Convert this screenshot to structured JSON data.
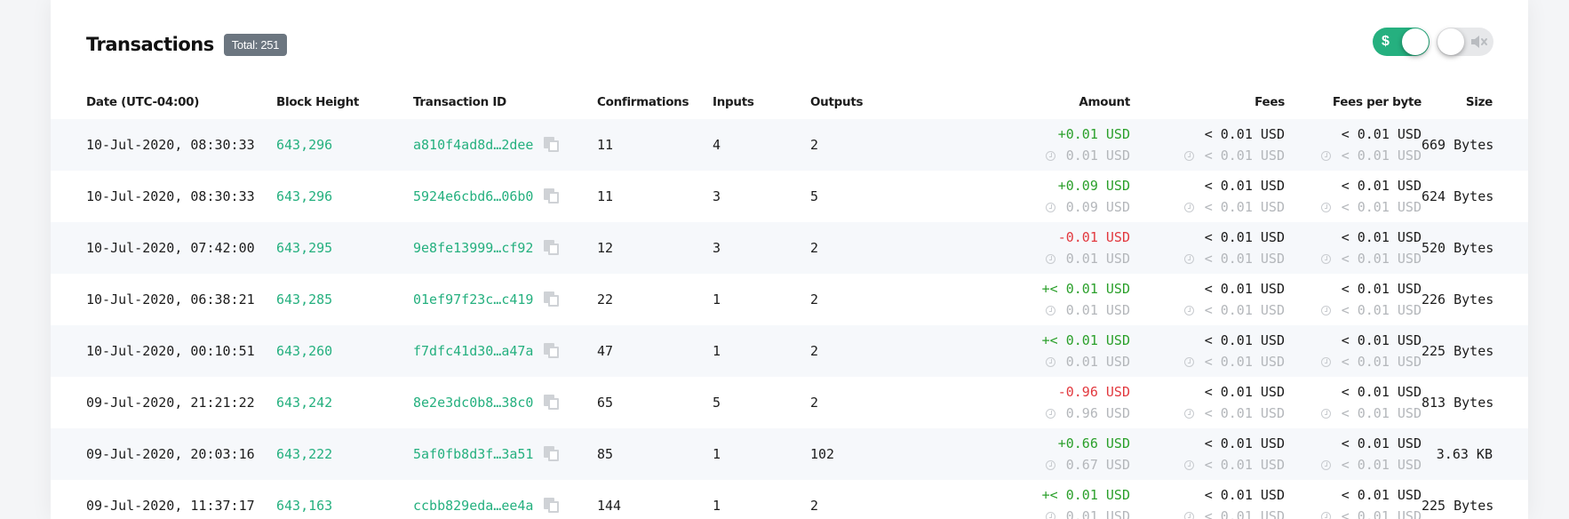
{
  "header": {
    "title": "Transactions",
    "total_badge": "Total: 251"
  },
  "toggles": {
    "currency": {
      "icon": "dollar-icon",
      "symbol": "$",
      "state": "on",
      "color": "#25b07f"
    },
    "sound": {
      "icon": "mute-icon",
      "symbol": "🔇",
      "state": "off"
    }
  },
  "columns": {
    "date": "Date (UTC-04:00)",
    "block": "Block Height",
    "txid": "Transaction ID",
    "confirmations": "Confirmations",
    "inputs": "Inputs",
    "outputs": "Outputs",
    "amount": "Amount",
    "fees": "Fees",
    "fees_per_byte": "Fees per byte",
    "size": "Size"
  },
  "rows": [
    {
      "date": "10-Jul-2020, 08:30:33",
      "block": "643,296",
      "txid": "a810f4ad8d…2dee",
      "confirmations": "11",
      "inputs": "4",
      "outputs": "2",
      "amount": "+0.01 USD",
      "amount_sign": "pos",
      "amount_hist": "0.01 USD",
      "fees": "< 0.01 USD",
      "fees_hist": "< 0.01 USD",
      "fpb": "< 0.01 USD",
      "fpb_hist": "< 0.01 USD",
      "size": "669 Bytes"
    },
    {
      "date": "10-Jul-2020, 08:30:33",
      "block": "643,296",
      "txid": "5924e6cbd6…06b0",
      "confirmations": "11",
      "inputs": "3",
      "outputs": "5",
      "amount": "+0.09 USD",
      "amount_sign": "pos",
      "amount_hist": "0.09 USD",
      "fees": "< 0.01 USD",
      "fees_hist": "< 0.01 USD",
      "fpb": "< 0.01 USD",
      "fpb_hist": "< 0.01 USD",
      "size": "624 Bytes"
    },
    {
      "date": "10-Jul-2020, 07:42:00",
      "block": "643,295",
      "txid": "9e8fe13999…cf92",
      "confirmations": "12",
      "inputs": "3",
      "outputs": "2",
      "amount": "-0.01 USD",
      "amount_sign": "neg",
      "amount_hist": "0.01 USD",
      "fees": "< 0.01 USD",
      "fees_hist": "< 0.01 USD",
      "fpb": "< 0.01 USD",
      "fpb_hist": "< 0.01 USD",
      "size": "520 Bytes"
    },
    {
      "date": "10-Jul-2020, 06:38:21",
      "block": "643,285",
      "txid": "01ef97f23c…c419",
      "confirmations": "22",
      "inputs": "1",
      "outputs": "2",
      "amount": "+< 0.01 USD",
      "amount_sign": "pos",
      "amount_hist": "0.01 USD",
      "fees": "< 0.01 USD",
      "fees_hist": "< 0.01 USD",
      "fpb": "< 0.01 USD",
      "fpb_hist": "< 0.01 USD",
      "size": "226 Bytes"
    },
    {
      "date": "10-Jul-2020, 00:10:51",
      "block": "643,260",
      "txid": "f7dfc41d30…a47a",
      "confirmations": "47",
      "inputs": "1",
      "outputs": "2",
      "amount": "+< 0.01 USD",
      "amount_sign": "pos",
      "amount_hist": "0.01 USD",
      "fees": "< 0.01 USD",
      "fees_hist": "< 0.01 USD",
      "fpb": "< 0.01 USD",
      "fpb_hist": "< 0.01 USD",
      "size": "225 Bytes"
    },
    {
      "date": "09-Jul-2020, 21:21:22",
      "block": "643,242",
      "txid": "8e2e3dc0b8…38c0",
      "confirmations": "65",
      "inputs": "5",
      "outputs": "2",
      "amount": "-0.96 USD",
      "amount_sign": "neg",
      "amount_hist": "0.96 USD",
      "fees": "< 0.01 USD",
      "fees_hist": "< 0.01 USD",
      "fpb": "< 0.01 USD",
      "fpb_hist": "< 0.01 USD",
      "size": "813 Bytes"
    },
    {
      "date": "09-Jul-2020, 20:03:16",
      "block": "643,222",
      "txid": "5af0fb8d3f…3a51",
      "confirmations": "85",
      "inputs": "1",
      "outputs": "102",
      "amount": "+0.66 USD",
      "amount_sign": "pos",
      "amount_hist": "0.67 USD",
      "fees": "< 0.01 USD",
      "fees_hist": "< 0.01 USD",
      "fpb": "< 0.01 USD",
      "fpb_hist": "< 0.01 USD",
      "size": "3.63 KB"
    },
    {
      "date": "09-Jul-2020, 11:37:17",
      "block": "643,163",
      "txid": "ccbb829eda…ee4a",
      "confirmations": "144",
      "inputs": "1",
      "outputs": "2",
      "amount": "+< 0.01 USD",
      "amount_sign": "pos",
      "amount_hist": "0.01 USD",
      "fees": "< 0.01 USD",
      "fees_hist": "< 0.01 USD",
      "fpb": "< 0.01 USD",
      "fpb_hist": "< 0.01 USD",
      "size": "225 Bytes"
    }
  ],
  "colors": {
    "link_green": "#25b07f",
    "positive": "#2ba02b",
    "negative": "#e2393f",
    "muted": "#b4b7bb",
    "badge_bg": "#6c7680",
    "row_stripe": "#f6f8fb"
  }
}
